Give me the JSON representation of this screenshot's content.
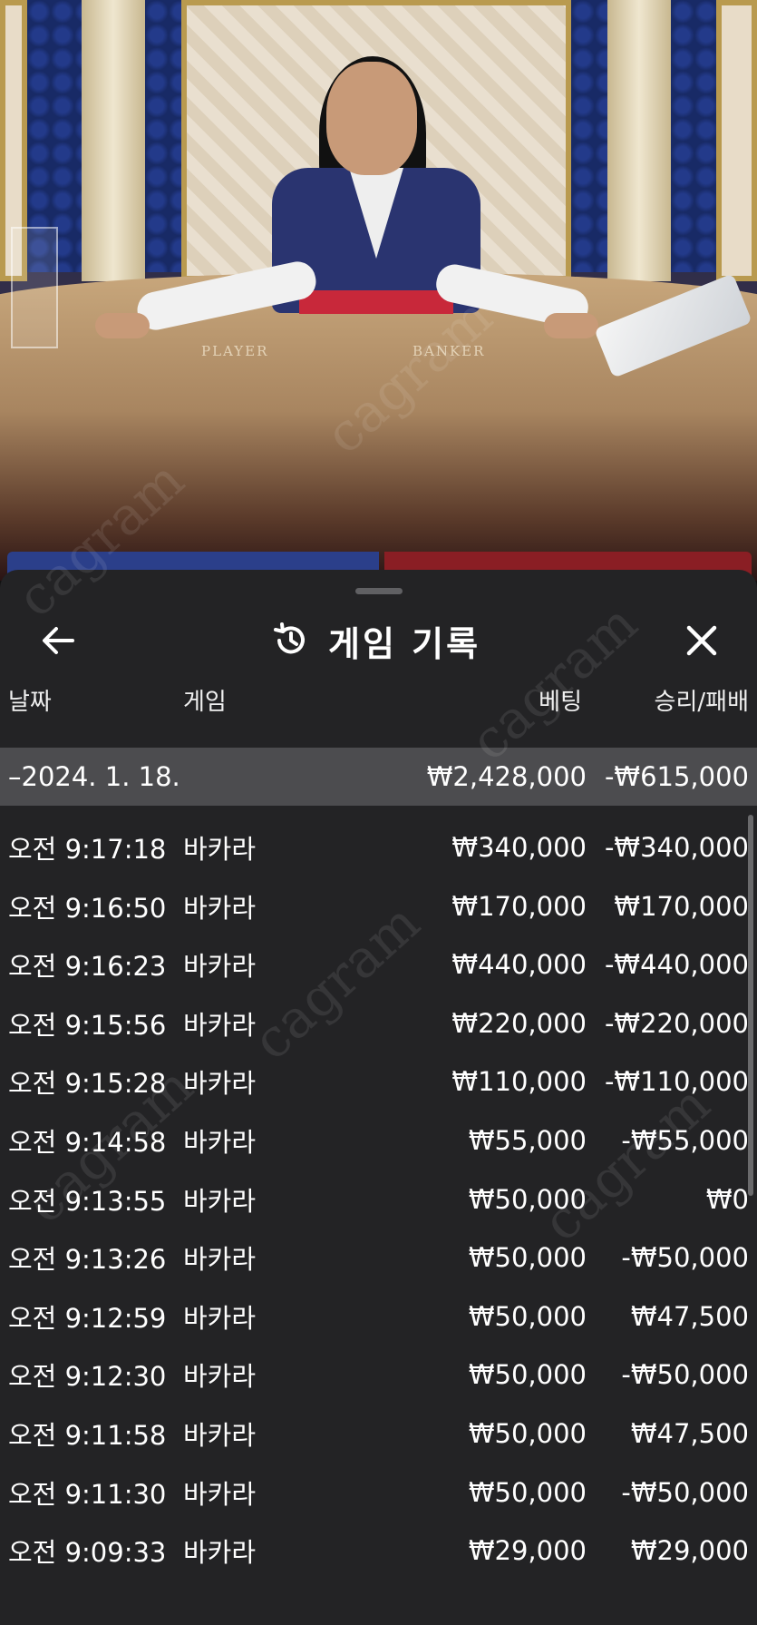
{
  "video": {
    "player_label": "PLAYER",
    "banker_label": "BANKER"
  },
  "panel": {
    "title": "게임 기록",
    "icons": {
      "back": "arrow-left-icon",
      "history": "history-clock-icon",
      "close": "close-x-icon"
    },
    "columns": {
      "date": "날짜",
      "game": "게임",
      "bet": "베팅",
      "result": "승리/패배"
    },
    "summary": {
      "date": "–2024. 1. 18.",
      "bet": "₩2,428,000",
      "result": "-₩615,000"
    },
    "rows": [
      {
        "time": "오전 9:17:18",
        "game": "바카라",
        "bet": "₩340,000",
        "result": "-₩340,000"
      },
      {
        "time": "오전 9:16:50",
        "game": "바카라",
        "bet": "₩170,000",
        "result": "₩170,000"
      },
      {
        "time": "오전 9:16:23",
        "game": "바카라",
        "bet": "₩440,000",
        "result": "-₩440,000"
      },
      {
        "time": "오전 9:15:56",
        "game": "바카라",
        "bet": "₩220,000",
        "result": "-₩220,000"
      },
      {
        "time": "오전 9:15:28",
        "game": "바카라",
        "bet": "₩110,000",
        "result": "-₩110,000"
      },
      {
        "time": "오전 9:14:58",
        "game": "바카라",
        "bet": "₩55,000",
        "result": "-₩55,000"
      },
      {
        "time": "오전 9:13:55",
        "game": "바카라",
        "bet": "₩50,000",
        "result": "₩0"
      },
      {
        "time": "오전 9:13:26",
        "game": "바카라",
        "bet": "₩50,000",
        "result": "-₩50,000"
      },
      {
        "time": "오전 9:12:59",
        "game": "바카라",
        "bet": "₩50,000",
        "result": "₩47,500"
      },
      {
        "time": "오전 9:12:30",
        "game": "바카라",
        "bet": "₩50,000",
        "result": "-₩50,000"
      },
      {
        "time": "오전 9:11:58",
        "game": "바카라",
        "bet": "₩50,000",
        "result": "₩47,500"
      },
      {
        "time": "오전 9:11:30",
        "game": "바카라",
        "bet": "₩50,000",
        "result": "-₩50,000"
      },
      {
        "time": "오전 9:09:33",
        "game": "바카라",
        "bet": "₩29,000",
        "result": "₩29,000"
      }
    ]
  },
  "watermark": "cagram",
  "colors": {
    "panel_bg": "#232325",
    "summary_bg": "#4c4c4f",
    "text": "#ffffff"
  }
}
